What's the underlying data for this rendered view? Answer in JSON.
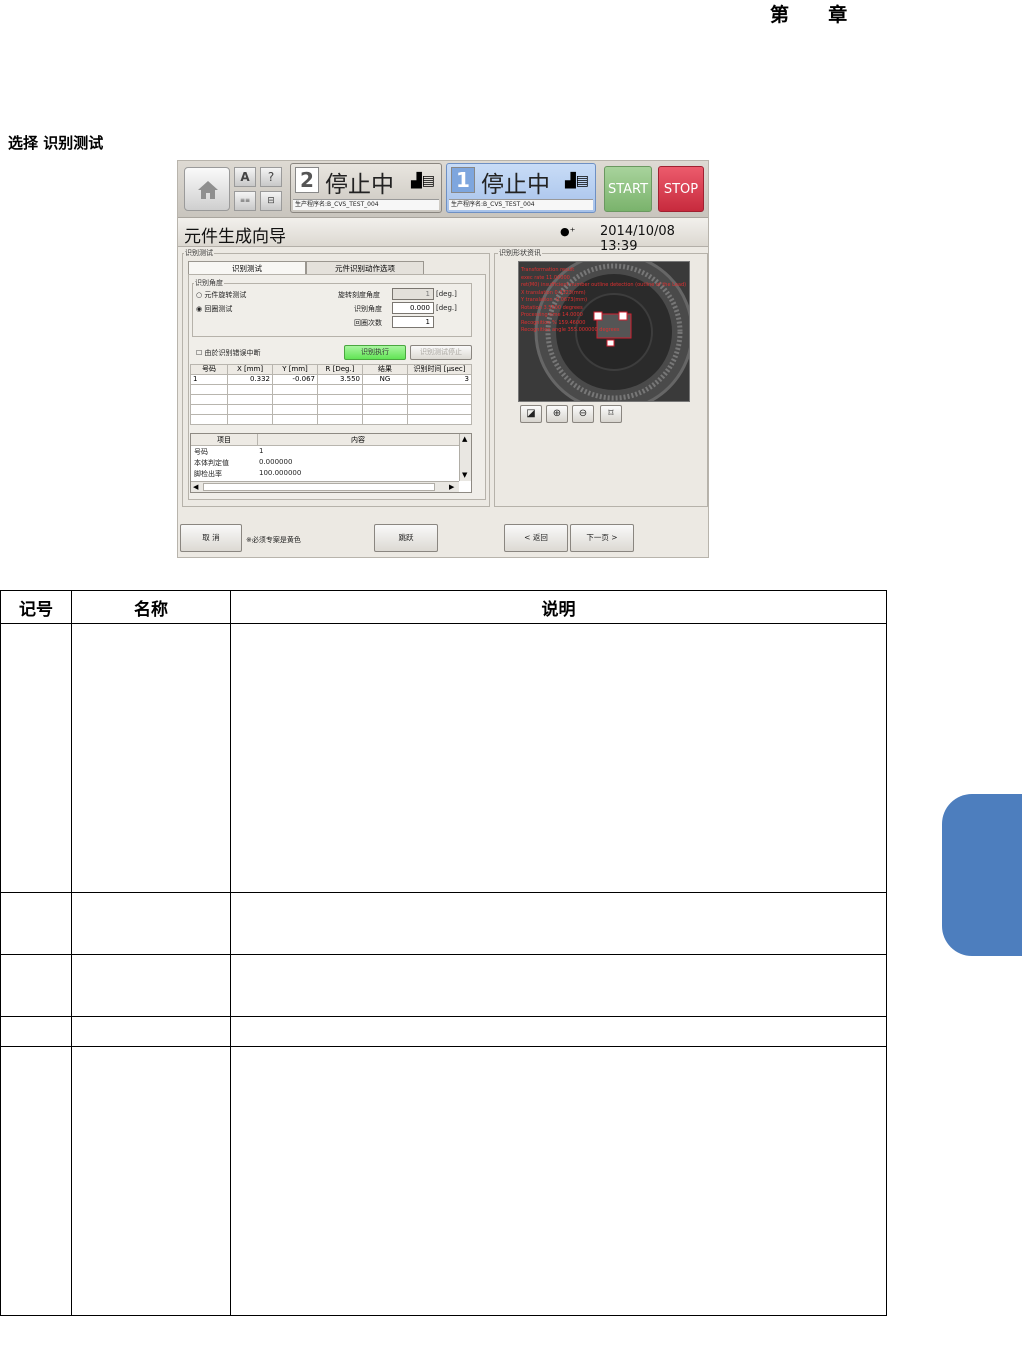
{
  "chapter_header": {
    "left": "第",
    "right": "章"
  },
  "section_title": "选择 识别测试",
  "screen": {
    "top_bar": {
      "small_buttons": [
        "A",
        "?"
      ],
      "lines": [
        {
          "number": "2",
          "status": "停止中",
          "program": "生产程序名:B_CVS_TEST_004"
        },
        {
          "number": "1",
          "status": "停止中",
          "program": "生产程序名:B_CVS_TEST_004"
        }
      ],
      "start_label": "START",
      "stop_label": "STOP"
    },
    "title": "元件生成向导",
    "datetime": "2014/10/08 13:39",
    "left_group_label": "识别测试",
    "tabs": [
      "识别测试",
      "元件识别动作选项"
    ],
    "angle_group_label": "识别角度",
    "radio_rotation": "元件旋转测试",
    "radio_loop": "回圈测试",
    "rotation_step_label": "旋转刻度角度",
    "rotation_step_value": "1",
    "rotation_step_unit": "[deg.]",
    "recog_angle_label": "识别角度",
    "recog_angle_value": "0.000",
    "recog_angle_unit": "[deg.]",
    "loop_count_label": "回圈次数",
    "loop_count_value": "1",
    "stop_on_error_label": "由於识别错误中断",
    "run_button": "识别执行",
    "stop_test_button": "识别测试停止",
    "result_headers": [
      "号码",
      "X [mm]",
      "Y [mm]",
      "R [Deg.]",
      "结果",
      "识别时间 [μsec]"
    ],
    "result_rows": [
      [
        "1",
        "0.332",
        "-0.067",
        "3.550",
        "NG",
        "3"
      ]
    ],
    "detail_headers": [
      "项目",
      "内容"
    ],
    "detail_rows": [
      [
        "号码",
        "1"
      ],
      [
        "本体判定值",
        "0.000000"
      ],
      [
        "脚检出率",
        "100.000000"
      ]
    ],
    "right_group_label": "识别形状资讯",
    "camera_overlay": [
      "Transformation result",
      "exec rate 11.00000",
      "ret(M0) insufficient number outline detection (outline of the Lead)",
      "X translation 0.3323(mm)",
      "Y translation -0.0673(mm)",
      "Rotation 3.5500 degrees",
      "Processing time 14.0000",
      "Recognition % 159.46000",
      "Recognition angle 355.000000 degrees"
    ],
    "zoom_icons": [
      "fit-icon",
      "zoom-in-icon",
      "zoom-out-icon",
      "fullsize-icon"
    ],
    "bottom": {
      "cancel": "取 消",
      "note": "※必须专案是黄色",
      "skip": "跳跃",
      "back": "< 返回",
      "next": "下一页 >"
    }
  },
  "doc_table": {
    "headers": [
      "记号",
      "名称",
      "说明"
    ]
  },
  "colors": {
    "side_tab": "#4d7ebe",
    "start": "#7ab36c",
    "stop": "#c72a3d",
    "run": "#62e455"
  }
}
